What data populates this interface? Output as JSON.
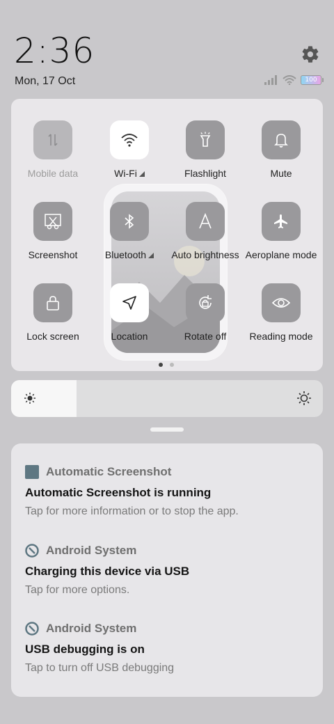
{
  "status_bar": {
    "time": "2:36",
    "date": "Mon, 17 Oct",
    "battery": "100"
  },
  "quick_settings": {
    "tiles": [
      {
        "label": "Mobile data",
        "icon": "mobile-data-icon",
        "state": "off"
      },
      {
        "label": "Wi-Fi",
        "icon": "wifi-icon",
        "state": "on"
      },
      {
        "label": "Flashlight",
        "icon": "flashlight-icon",
        "state": "off"
      },
      {
        "label": "Mute",
        "icon": "bell-icon",
        "state": "off"
      },
      {
        "label": "Screenshot",
        "icon": "screenshot-icon",
        "state": "off"
      },
      {
        "label": "Bluetooth",
        "icon": "bluetooth-icon",
        "state": "off"
      },
      {
        "label": "Auto brightness",
        "icon": "auto-brightness-icon",
        "state": "off"
      },
      {
        "label": "Aeroplane mode",
        "icon": "airplane-icon",
        "state": "off"
      },
      {
        "label": "Lock screen",
        "icon": "lock-icon",
        "state": "off"
      },
      {
        "label": "Location",
        "icon": "location-arrow-icon",
        "state": "on"
      },
      {
        "label": "Rotate off",
        "icon": "rotate-lock-icon",
        "state": "off"
      },
      {
        "label": "Reading mode",
        "icon": "eye-icon",
        "state": "off"
      }
    ],
    "page_index": 1,
    "page_count": 2
  },
  "brightness": {
    "level": 0.21
  },
  "notifications": [
    {
      "app": "Automatic Screenshot",
      "app_icon": "app-square-icon",
      "title": "Automatic Screenshot is running",
      "text": "Tap for more information or to stop the app."
    },
    {
      "app": "Android System",
      "app_icon": "android-system-icon",
      "title": "Charging this device via USB",
      "text": "Tap for more options."
    },
    {
      "app": "Android System",
      "app_icon": "android-system-icon",
      "title": "USB debugging is on",
      "text": "Tap to turn off USB debugging"
    }
  ],
  "colors": {
    "background": "#c9c8cb",
    "panel": "#e9e7ea",
    "tile_off": "#9a999c",
    "tile_on": "#ffffff",
    "app_icon": "#5e7782"
  }
}
